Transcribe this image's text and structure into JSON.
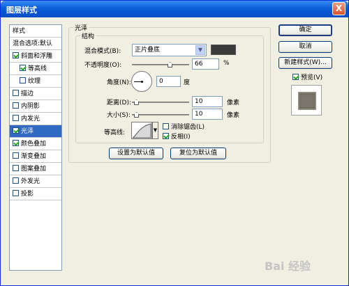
{
  "window": {
    "title": "图层样式",
    "close_label": "X"
  },
  "left_panel": {
    "styles_label": "样式",
    "blend_label": "混合选项:默认",
    "items": [
      {
        "label": "斜面和浮雕",
        "checked": true
      },
      {
        "label": "等高线",
        "checked": true
      },
      {
        "label": "纹理",
        "checked": false
      },
      {
        "label": "描边",
        "checked": false
      },
      {
        "label": "内阴影",
        "checked": false
      },
      {
        "label": "内发光",
        "checked": false
      },
      {
        "label": "光泽",
        "checked": true
      },
      {
        "label": "颜色叠加",
        "checked": true
      },
      {
        "label": "渐变叠加",
        "checked": false
      },
      {
        "label": "图案叠加",
        "checked": false
      },
      {
        "label": "外发光",
        "checked": false
      },
      {
        "label": "投影",
        "checked": false
      }
    ]
  },
  "satin": {
    "group_title": "光泽",
    "structure_title": "结构",
    "blend_mode_label": "混合模式(B):",
    "blend_mode_value": "正片叠底",
    "blend_color": "#333333",
    "opacity_label": "不透明度(O):",
    "opacity_value": "66",
    "opacity_unit": "%",
    "angle_label": "角度(N):",
    "angle_value": "0",
    "angle_unit": "度",
    "distance_label": "距离(D):",
    "distance_value": "10",
    "distance_unit": "像素",
    "size_label": "大小(S):",
    "size_value": "10",
    "size_unit": "像素",
    "contour_label": "等高线:",
    "antialias_label": "消除锯齿(L)",
    "antialias_checked": false,
    "invert_label": "反相(I)",
    "invert_checked": true,
    "make_default_label": "设置为默认值",
    "reset_default_label": "复位为默认值"
  },
  "right_panel": {
    "ok_label": "确定",
    "cancel_label": "取消",
    "new_style_label": "新建样式(W)...",
    "preview_label": "预览(V)",
    "preview_checked": true
  },
  "watermark": "Bai 经验"
}
